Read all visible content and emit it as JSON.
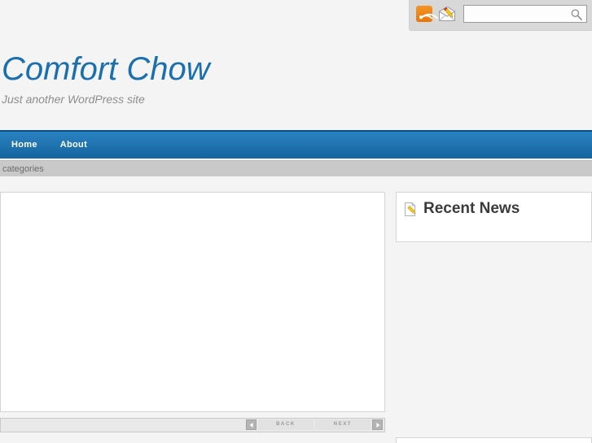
{
  "top_bar": {
    "rss_icon": "rss-icon",
    "mail_icon": "mail-pencil-icon",
    "search": {
      "value": "",
      "placeholder": "",
      "button_icon": "search-magnifier-icon"
    }
  },
  "branding": {
    "site_title": "Comfort Chow",
    "site_description": "Just another WordPress site",
    "title_color": "#1a6faf",
    "description_color": "#8d8d8d"
  },
  "navigation": {
    "accent_color": "#14649e",
    "items": [
      {
        "label": "Home"
      },
      {
        "label": "About"
      }
    ]
  },
  "categories_bar": {
    "label": "categories",
    "background": "#c9c9c9"
  },
  "content": {
    "body_text": ""
  },
  "pager": {
    "prev_icon": "triangle-left-icon",
    "back_label": "BACK",
    "next_label": "NEXT",
    "next_icon": "triangle-right-icon"
  },
  "sidebar": {
    "widgets": [
      {
        "icon": "page-pencil-icon",
        "title": "Recent News",
        "items": []
      }
    ]
  }
}
